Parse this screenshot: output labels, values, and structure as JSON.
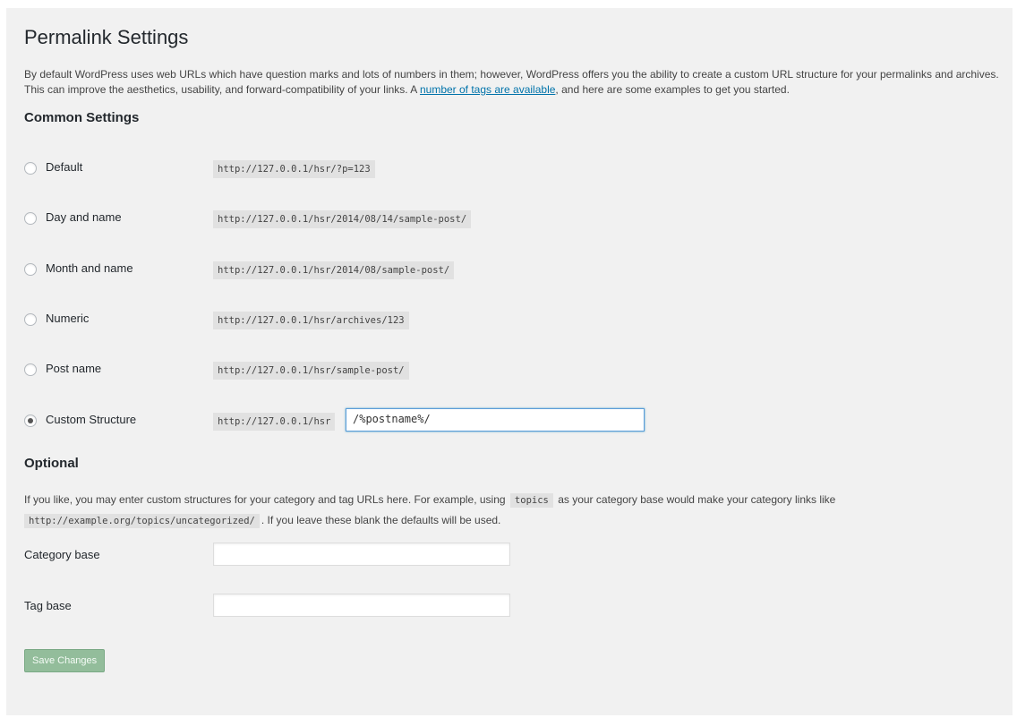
{
  "page": {
    "title": "Permalink Settings",
    "intro_before_link": "By default WordPress uses web URLs which have question marks and lots of numbers in them; however, WordPress offers you the ability to create a custom URL structure for your permalinks and archives. This can improve the aesthetics, usability, and forward-compatibility of your links. A ",
    "intro_link": "number of tags are available",
    "intro_after_link": ", and here are some examples to get you started."
  },
  "common_settings": {
    "title": "Common Settings",
    "options": [
      {
        "label": "Default",
        "example": "http://127.0.0.1/hsr/?p=123",
        "checked": false
      },
      {
        "label": "Day and name",
        "example": "http://127.0.0.1/hsr/2014/08/14/sample-post/",
        "checked": false
      },
      {
        "label": "Month and name",
        "example": "http://127.0.0.1/hsr/2014/08/sample-post/",
        "checked": false
      },
      {
        "label": "Numeric",
        "example": "http://127.0.0.1/hsr/archives/123",
        "checked": false
      },
      {
        "label": "Post name",
        "example": "http://127.0.0.1/hsr/sample-post/",
        "checked": false
      },
      {
        "label": "Custom Structure",
        "example": "http://127.0.0.1/hsr",
        "checked": true,
        "value": "/%postname%/"
      }
    ]
  },
  "optional": {
    "title": "Optional",
    "text_1": "If you like, you may enter custom structures for your category and tag URLs here. For example, using",
    "code_1": "topics",
    "text_2": "as your category base would make your category links like",
    "code_2": "http://example.org/topics/uncategorized/",
    "text_3": ". If you leave these blank the defaults will be used.",
    "category_base_label": "Category base",
    "category_base_value": "",
    "tag_base_label": "Tag base",
    "tag_base_value": ""
  },
  "save_button_label": "Save Changes",
  "colors": {
    "background": "#f1f1f1",
    "link": "#0073aa",
    "button_disabled": "#93bd9b",
    "code_bg": "#e1e1e1"
  }
}
